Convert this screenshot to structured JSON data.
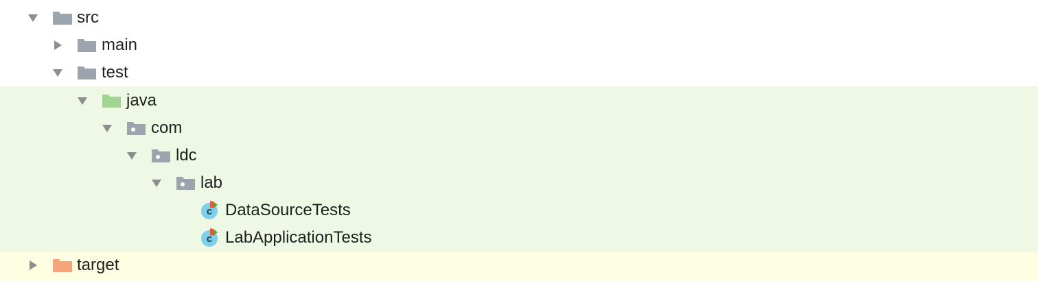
{
  "tree": [
    {
      "label": "src",
      "expanded": true,
      "icon": "folder-icon",
      "bg": "white",
      "depth": 0
    },
    {
      "label": "main",
      "expanded": false,
      "icon": "folder-icon",
      "bg": "white",
      "depth": 1
    },
    {
      "label": "test",
      "expanded": true,
      "icon": "folder-icon",
      "bg": "white",
      "depth": 1
    },
    {
      "label": "java",
      "expanded": true,
      "icon": "test-source-root-icon",
      "bg": "green",
      "depth": 2
    },
    {
      "label": "com",
      "expanded": true,
      "icon": "package-icon",
      "bg": "green",
      "depth": 3
    },
    {
      "label": "ldc",
      "expanded": true,
      "icon": "package-icon",
      "bg": "green",
      "depth": 4
    },
    {
      "label": "lab",
      "expanded": true,
      "icon": "package-icon",
      "bg": "green",
      "depth": 5
    },
    {
      "label": "DataSourceTests",
      "expanded": null,
      "icon": "test-class-icon",
      "bg": "green",
      "depth": 6
    },
    {
      "label": "LabApplicationTests",
      "expanded": null,
      "icon": "test-class-icon",
      "bg": "green",
      "depth": 6
    },
    {
      "label": "target",
      "expanded": false,
      "icon": "excluded-folder-icon",
      "bg": "yellow",
      "depth": 0
    }
  ],
  "colors": {
    "folder": "#9ca5ad",
    "test_root": "#9fd58f",
    "excluded": "#f6a47a",
    "class_circle": "#7dd0ea",
    "row_green": "#eef8e5",
    "row_yellow": "#fefee2",
    "toggle": "#8e8e8e"
  }
}
